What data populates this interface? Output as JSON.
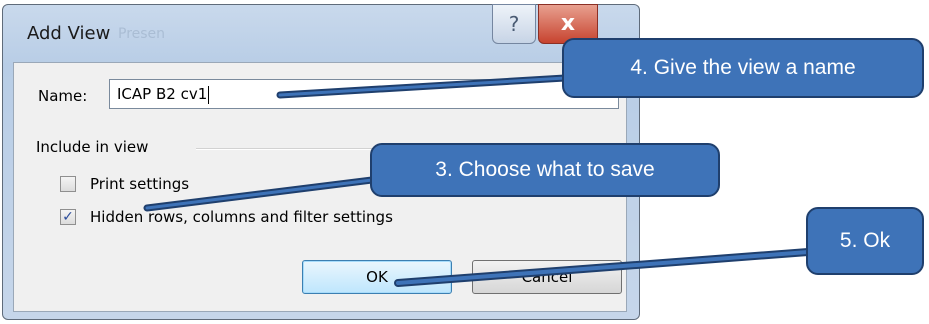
{
  "dialog": {
    "title": "Add View",
    "title_ghost": "Presen",
    "help_symbol": "?",
    "close_symbol": "x",
    "name_label": "Name:",
    "name_value": "ICAP B2 cv1",
    "group_label": "Include in view",
    "checkboxes": [
      {
        "label": "Print settings",
        "checked": false
      },
      {
        "label": "Hidden rows, columns and filter settings",
        "checked": true
      }
    ],
    "ok_label": "OK",
    "cancel_label": "Cancel"
  },
  "callouts": {
    "step4": "4. Give the view a name",
    "step3": "3. Choose what to save",
    "step5": "5. Ok"
  },
  "colors": {
    "callout_fill": "#3e73b8",
    "callout_border": "#1f3f6d"
  }
}
